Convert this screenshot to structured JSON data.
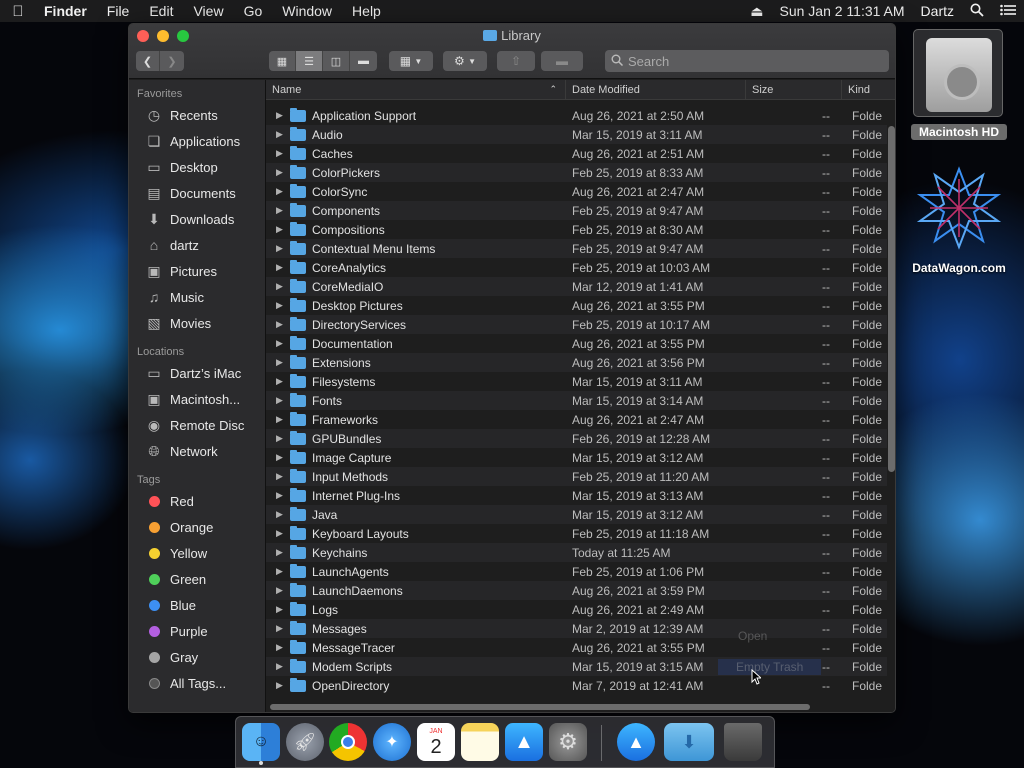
{
  "menubar": {
    "app_name": "Finder",
    "menus": [
      "File",
      "Edit",
      "View",
      "Go",
      "Window",
      "Help"
    ],
    "clock": "Sun Jan 2  11:31 AM",
    "user": "Dartz"
  },
  "window": {
    "title": "Library",
    "search_placeholder": "Search"
  },
  "sidebar": {
    "favorites_header": "Favorites",
    "favorites": [
      {
        "label": "Recents",
        "icon": "clock-icon"
      },
      {
        "label": "Applications",
        "icon": "applications-icon"
      },
      {
        "label": "Desktop",
        "icon": "desktop-icon"
      },
      {
        "label": "Documents",
        "icon": "document-icon"
      },
      {
        "label": "Downloads",
        "icon": "download-icon"
      },
      {
        "label": "dartz",
        "icon": "home-icon"
      },
      {
        "label": "Pictures",
        "icon": "camera-icon"
      },
      {
        "label": "Music",
        "icon": "music-note-icon"
      },
      {
        "label": "Movies",
        "icon": "film-icon"
      }
    ],
    "locations_header": "Locations",
    "locations": [
      {
        "label": "Dartz’s iMac",
        "icon": "imac-icon"
      },
      {
        "label": "Macintosh...",
        "icon": "hard-drive-icon"
      },
      {
        "label": "Remote Disc",
        "icon": "disc-icon"
      },
      {
        "label": "Network",
        "icon": "globe-icon"
      }
    ],
    "tags_header": "Tags",
    "tags": [
      {
        "label": "Red",
        "color": "#ff5257"
      },
      {
        "label": "Orange",
        "color": "#f7a033"
      },
      {
        "label": "Yellow",
        "color": "#f5d130"
      },
      {
        "label": "Green",
        "color": "#4fd05a"
      },
      {
        "label": "Blue",
        "color": "#3d8ff2"
      },
      {
        "label": "Purple",
        "color": "#b35fe0"
      },
      {
        "label": "Gray",
        "color": "#a5a5a5"
      }
    ],
    "all_tags": "All Tags..."
  },
  "columns": {
    "name": "Name",
    "date": "Date Modified",
    "size": "Size",
    "kind": "Kind"
  },
  "rows": [
    {
      "name": "Application Support",
      "date": "Aug 26, 2021 at 2:50 AM",
      "size": "--",
      "kind": "Folde"
    },
    {
      "name": "Audio",
      "date": "Mar 15, 2019 at 3:11 AM",
      "size": "--",
      "kind": "Folde"
    },
    {
      "name": "Caches",
      "date": "Aug 26, 2021 at 2:51 AM",
      "size": "--",
      "kind": "Folde"
    },
    {
      "name": "ColorPickers",
      "date": "Feb 25, 2019 at 8:33 AM",
      "size": "--",
      "kind": "Folde"
    },
    {
      "name": "ColorSync",
      "date": "Aug 26, 2021 at 2:47 AM",
      "size": "--",
      "kind": "Folde"
    },
    {
      "name": "Components",
      "date": "Feb 25, 2019 at 9:47 AM",
      "size": "--",
      "kind": "Folde"
    },
    {
      "name": "Compositions",
      "date": "Feb 25, 2019 at 8:30 AM",
      "size": "--",
      "kind": "Folde"
    },
    {
      "name": "Contextual Menu Items",
      "date": "Feb 25, 2019 at 9:47 AM",
      "size": "--",
      "kind": "Folde"
    },
    {
      "name": "CoreAnalytics",
      "date": "Feb 25, 2019 at 10:03 AM",
      "size": "--",
      "kind": "Folde"
    },
    {
      "name": "CoreMediaIO",
      "date": "Mar 12, 2019 at 1:41 AM",
      "size": "--",
      "kind": "Folde"
    },
    {
      "name": "Desktop Pictures",
      "date": "Aug 26, 2021 at 3:55 PM",
      "size": "--",
      "kind": "Folde"
    },
    {
      "name": "DirectoryServices",
      "date": "Feb 25, 2019 at 10:17 AM",
      "size": "--",
      "kind": "Folde"
    },
    {
      "name": "Documentation",
      "date": "Aug 26, 2021 at 3:55 PM",
      "size": "--",
      "kind": "Folde"
    },
    {
      "name": "Extensions",
      "date": "Aug 26, 2021 at 3:56 PM",
      "size": "--",
      "kind": "Folde"
    },
    {
      "name": "Filesystems",
      "date": "Mar 15, 2019 at 3:11 AM",
      "size": "--",
      "kind": "Folde"
    },
    {
      "name": "Fonts",
      "date": "Mar 15, 2019 at 3:14 AM",
      "size": "--",
      "kind": "Folde"
    },
    {
      "name": "Frameworks",
      "date": "Aug 26, 2021 at 2:47 AM",
      "size": "--",
      "kind": "Folde"
    },
    {
      "name": "GPUBundles",
      "date": "Feb 26, 2019 at 12:28 AM",
      "size": "--",
      "kind": "Folde"
    },
    {
      "name": "Image Capture",
      "date": "Mar 15, 2019 at 3:12 AM",
      "size": "--",
      "kind": "Folde"
    },
    {
      "name": "Input Methods",
      "date": "Feb 25, 2019 at 11:20 AM",
      "size": "--",
      "kind": "Folde"
    },
    {
      "name": "Internet Plug-Ins",
      "date": "Mar 15, 2019 at 3:13 AM",
      "size": "--",
      "kind": "Folde"
    },
    {
      "name": "Java",
      "date": "Mar 15, 2019 at 3:12 AM",
      "size": "--",
      "kind": "Folde"
    },
    {
      "name": "Keyboard Layouts",
      "date": "Feb 25, 2019 at 11:18 AM",
      "size": "--",
      "kind": "Folde"
    },
    {
      "name": "Keychains",
      "date": "Today at 11:25 AM",
      "size": "--",
      "kind": "Folde"
    },
    {
      "name": "LaunchAgents",
      "date": "Feb 25, 2019 at 1:06 PM",
      "size": "--",
      "kind": "Folde"
    },
    {
      "name": "LaunchDaemons",
      "date": "Aug 26, 2021 at 3:59 PM",
      "size": "--",
      "kind": "Folde"
    },
    {
      "name": "Logs",
      "date": "Aug 26, 2021 at 2:49 AM",
      "size": "--",
      "kind": "Folde"
    },
    {
      "name": "Messages",
      "date": "Mar 2, 2019 at 12:39 AM",
      "size": "--",
      "kind": "Folde"
    },
    {
      "name": "MessageTracer",
      "date": "Aug 26, 2021 at 3:55 PM",
      "size": "--",
      "kind": "Folde"
    },
    {
      "name": "Modem Scripts",
      "date": "Mar 15, 2019 at 3:15 AM",
      "size": "--",
      "kind": "Folde"
    },
    {
      "name": "OpenDirectory",
      "date": "Mar 7, 2019 at 12:41 AM",
      "size": "--",
      "kind": "Folde"
    }
  ],
  "ghost_menu": {
    "open": "Open",
    "empty_trash": "Empty Trash"
  },
  "desktop": {
    "hd_label": "Macintosh HD",
    "dw_label": "DataWagon.com"
  },
  "dock": {
    "calendar_month": "JAN",
    "calendar_day": "2",
    "apps": [
      "finder-icon",
      "launchpad-icon",
      "chrome-icon",
      "safari-icon",
      "calendar-icon",
      "notes-icon",
      "app-store-icon",
      "system-preferences-icon",
      "app-store-download-icon",
      "downloads-folder-icon",
      "trash-icon"
    ]
  }
}
